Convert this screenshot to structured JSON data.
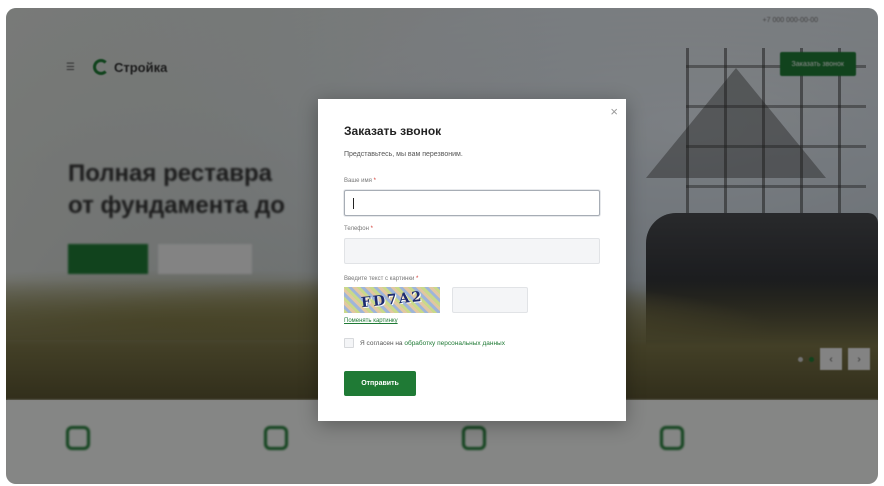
{
  "site": {
    "brand": "Стройка",
    "phone": "+7 000 000-00-00",
    "header_button": "Заказать звонок"
  },
  "hero": {
    "title_line1": "Полная реставра",
    "title_line2": "от фундамента до"
  },
  "modal": {
    "title": "Заказать звонок",
    "subtitle": "Представьтесь, мы вам перезвоним.",
    "name_label": "Ваше имя",
    "phone_label": "Телефон",
    "captcha_label": "Введите текст с картинки",
    "required_mark": "*",
    "captcha_text": "FD7A2",
    "captcha_refresh": "Поменять картинку",
    "consent_prefix": "Я согласен на ",
    "consent_link": "обработку персональных данных",
    "submit": "Отправить",
    "close_glyph": "×"
  },
  "colors": {
    "brand_green": "#1f7a35",
    "required_red": "#d0342c"
  },
  "icons": [
    "close-icon",
    "burger-menu-icon",
    "logo-icon",
    "arrow-left-icon",
    "arrow-right-icon"
  ]
}
